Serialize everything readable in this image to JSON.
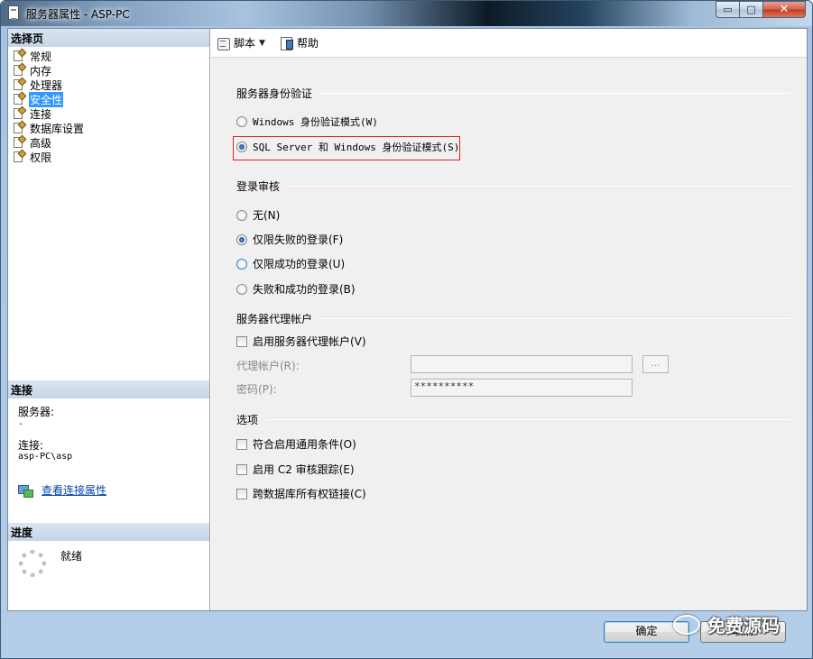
{
  "window": {
    "title": "服务器属性 - ASP-PC",
    "min_glyph": "▭",
    "max_glyph": "□",
    "close_glyph": "✕"
  },
  "left": {
    "select_page_header": "选择页",
    "pages": [
      {
        "label": "常规",
        "selected": false
      },
      {
        "label": "内存",
        "selected": false
      },
      {
        "label": "处理器",
        "selected": false
      },
      {
        "label": "安全性",
        "selected": true
      },
      {
        "label": "连接",
        "selected": false
      },
      {
        "label": "数据库设置",
        "selected": false
      },
      {
        "label": "高级",
        "selected": false
      },
      {
        "label": "权限",
        "selected": false
      }
    ],
    "connection_header": "连接",
    "server_label": "服务器:",
    "server_value": ".",
    "connection_label": "连接:",
    "connection_value": "asp-PC\\asp",
    "view_connection_link": "查看连接属性",
    "progress_header": "进度",
    "progress_status": "就绪"
  },
  "toolbar": {
    "script_label": "脚本",
    "help_label": "帮助"
  },
  "auth": {
    "title": "服务器身份验证",
    "windows_mode": "Windows 身份验证模式(W)",
    "mixed_mode": "SQL Server 和 Windows 身份验证模式(S)",
    "selected": "mixed"
  },
  "audit": {
    "title": "登录审核",
    "none": "无(N)",
    "failed_only": "仅限失败的登录(F)",
    "success_only": "仅限成功的登录(U)",
    "both": "失败和成功的登录(B)",
    "selected": "failed_only"
  },
  "proxy": {
    "title": "服务器代理帐户",
    "enable_label": "启用服务器代理帐户(V)",
    "account_label": "代理帐户(R):",
    "account_value": "",
    "password_label": "密码(P):",
    "password_value": "**********",
    "browse_label": "..."
  },
  "options": {
    "title": "选项",
    "common_criteria": "符合启用通用条件(O)",
    "c2_audit": "启用 C2 审核跟踪(E)",
    "cross_db_chaining": "跨数据库所有权链接(C)"
  },
  "buttons": {
    "ok": "确定",
    "cancel": "取消"
  },
  "watermark": {
    "text": "免费源码"
  },
  "colors": {
    "selection": "#3399ff",
    "highlight_border": "#e02020",
    "link": "#0645ad"
  }
}
